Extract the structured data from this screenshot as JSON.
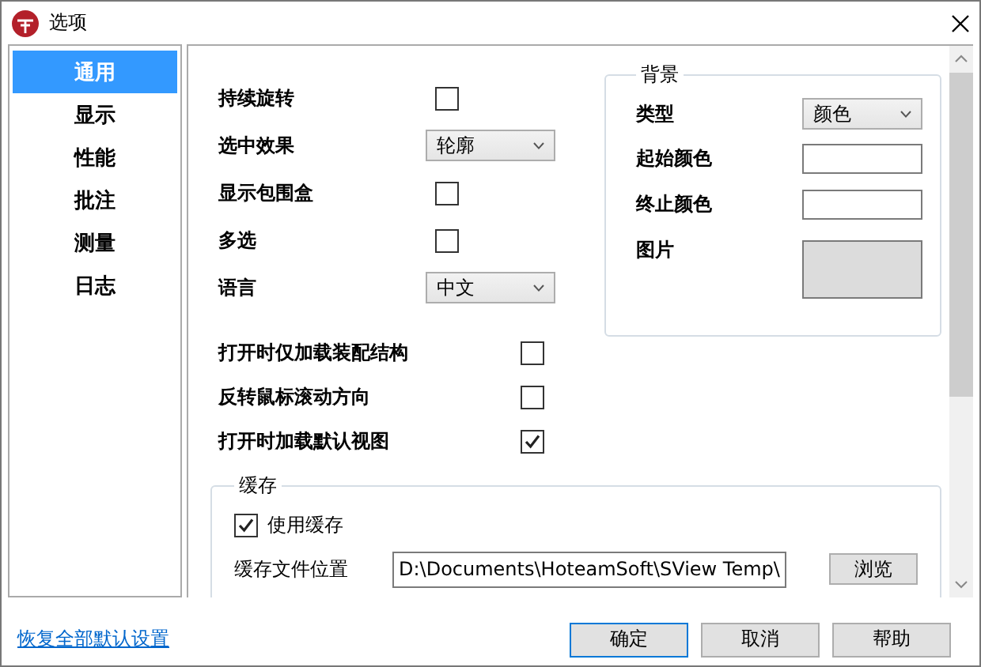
{
  "window": {
    "title": "选项"
  },
  "sidebar": {
    "items": [
      {
        "label": "通用",
        "selected": true
      },
      {
        "label": "显示",
        "selected": false
      },
      {
        "label": "性能",
        "selected": false
      },
      {
        "label": "批注",
        "selected": false
      },
      {
        "label": "测量",
        "selected": false
      },
      {
        "label": "日志",
        "selected": false
      }
    ]
  },
  "general": {
    "left_options": [
      {
        "kind": "checkbox",
        "label": "持续旋转",
        "checked": false
      },
      {
        "kind": "dropdown",
        "label": "选中效果",
        "value": "轮廓"
      },
      {
        "kind": "checkbox",
        "label": "显示包围盒",
        "checked": false
      },
      {
        "kind": "checkbox",
        "label": "多选",
        "checked": false
      },
      {
        "kind": "dropdown",
        "label": "语言",
        "value": "中文"
      }
    ],
    "background": {
      "title": "背景",
      "fields": [
        {
          "kind": "dropdown",
          "label": "类型",
          "value": "颜色"
        },
        {
          "kind": "color",
          "label": "起始颜色"
        },
        {
          "kind": "color",
          "label": "终止颜色"
        },
        {
          "kind": "image",
          "label": "图片"
        }
      ]
    },
    "wide_options": [
      {
        "label": "打开时仅加载装配结构",
        "checked": false
      },
      {
        "label": "反转鼠标滚动方向",
        "checked": false
      },
      {
        "label": "打开时加载默认视图",
        "checked": true
      }
    ],
    "cache": {
      "title": "缓存",
      "use_cache": {
        "label": "使用缓存",
        "checked": true
      },
      "location": {
        "label": "缓存文件位置",
        "value": "D:\\Documents\\HoteamSoft\\SView Temp\\"
      },
      "browse": "浏览"
    }
  },
  "reset_link": "恢复全部默认设置",
  "buttons": [
    {
      "label": "确定",
      "default": true
    },
    {
      "label": "取消",
      "default": false
    },
    {
      "label": "帮助",
      "default": false
    }
  ]
}
